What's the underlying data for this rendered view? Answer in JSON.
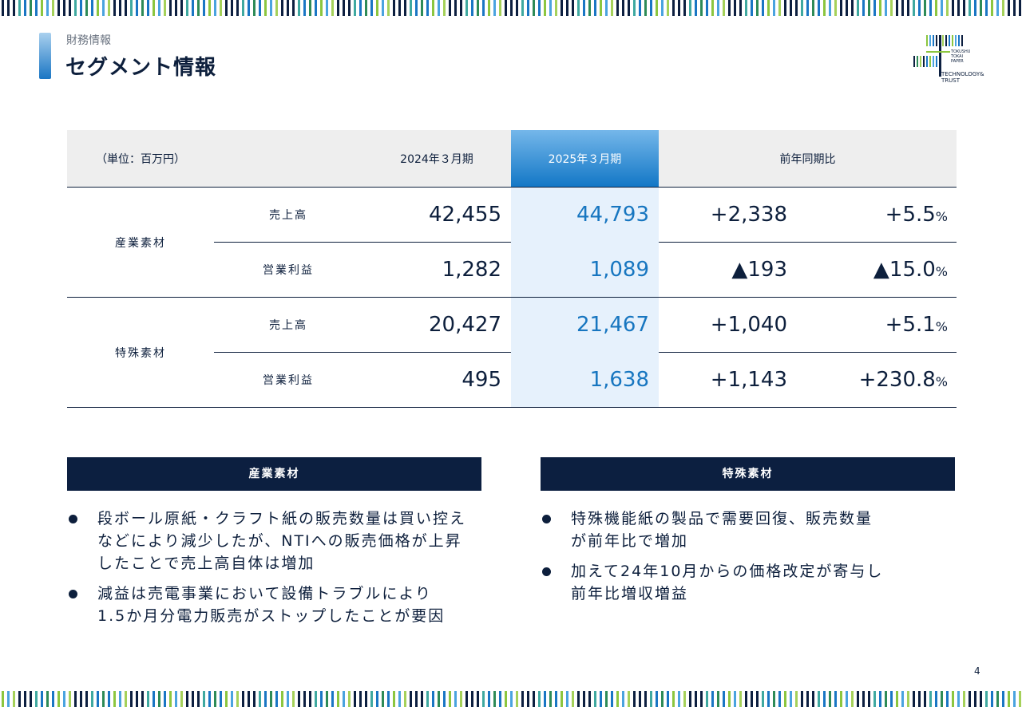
{
  "header": {
    "kicker": "財務情報",
    "title": "セグメント情報"
  },
  "logo": {
    "name_lines": [
      "TOKUSHU",
      "TOKAI",
      "PAPER"
    ],
    "tagline_lines": [
      "TECHNOLOGY&",
      "TRUST"
    ]
  },
  "table": {
    "unit": "（単位：百万円）",
    "col_prev": "2024年３月期",
    "col_cur": "2025年３月期",
    "col_yoy": "前年同期比",
    "groups": [
      {
        "segment": "産業素材",
        "rows": [
          {
            "item": "売上高",
            "prev": "42,455",
            "cur": "44,793",
            "diff": "+2,338",
            "ratio": "+5.5",
            "ratio_unit": "%"
          },
          {
            "item": "営業利益",
            "prev": "1,282",
            "cur": "1,089",
            "diff": "▲193",
            "ratio": "▲15.0",
            "ratio_unit": "%"
          }
        ]
      },
      {
        "segment": "特殊素材",
        "rows": [
          {
            "item": "売上高",
            "prev": "20,427",
            "cur": "21,467",
            "diff": "+1,040",
            "ratio": "+5.1",
            "ratio_unit": "%"
          },
          {
            "item": "営業利益",
            "prev": "495",
            "cur": "1,638",
            "diff": "+1,143",
            "ratio": "+230.8",
            "ratio_unit": "%"
          }
        ]
      }
    ]
  },
  "panels": [
    {
      "title": "産業素材",
      "bullets": [
        [
          "段ボール原紙・クラフト紙の販売数量は買い控え",
          "などにより減少したが、NTIへの販売価格が上昇",
          "したことで売上高自体は増加"
        ],
        [
          "減益は売電事業において設備トラブルにより",
          "1.5か月分電力販売がストップしたことが要因"
        ]
      ]
    },
    {
      "title": "特殊素材",
      "bullets": [
        [
          "特殊機能紙の製品で需要回復、販売数量",
          "が前年比で増加"
        ],
        [
          "加えて24年10月からの価格改定が寄与し",
          "前年比増収増益"
        ]
      ]
    }
  ],
  "page_number": "4",
  "colors": {
    "navy": "#0c1f40",
    "accent_blue": "#1776c0",
    "highlight": "#e6f1fc",
    "stripe_green": "#8cc63f"
  }
}
